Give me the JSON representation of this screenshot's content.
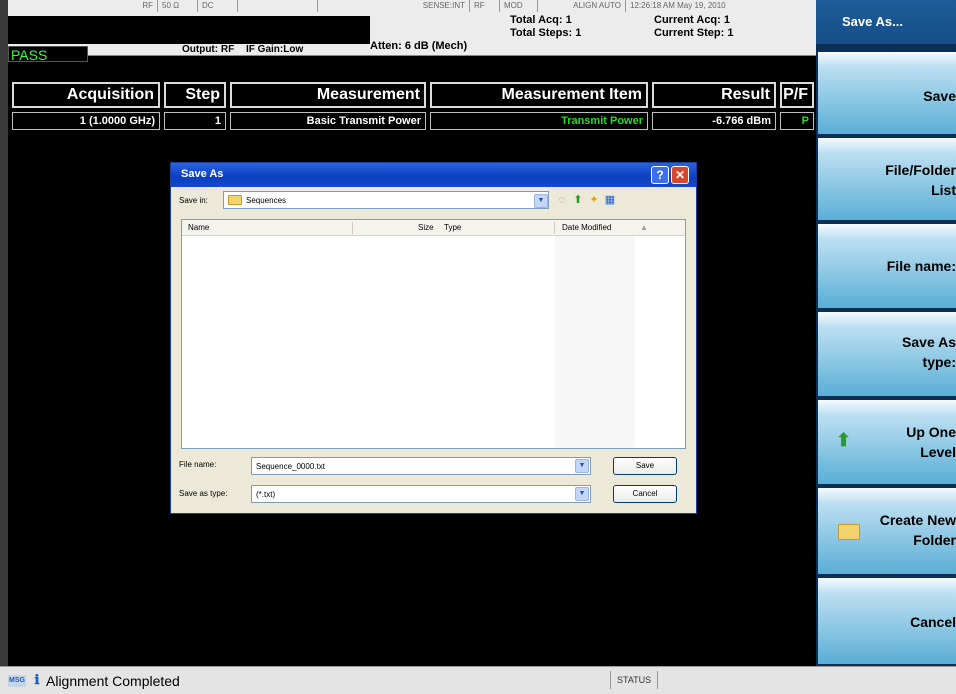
{
  "settings_bar": {
    "rf": "RF",
    "impedance": "50 Ω",
    "coupling": "DC",
    "sense": "SENSE:INT",
    "rf2": "RF",
    "mod": "MOD",
    "align": "ALIGN AUTO",
    "datetime": "12:26:18 AM May 19, 2010",
    "total_acq": "Total Acq: 1",
    "total_steps": "Total Steps: 1",
    "current_acq": "Current Acq: 1",
    "current_step": "Current Step: 1",
    "output": "Output: RF",
    "if_gain": "IF Gain:Low",
    "atten": "Atten: 6 dB (Mech)",
    "pass": "PASS"
  },
  "results_table": {
    "headers": [
      "Acquisition",
      "Step",
      "Measurement",
      "Measurement Item",
      "Result",
      "P/F"
    ],
    "row": {
      "acquisition": "1 (1.0000 GHz)",
      "step": "1",
      "measurement": "Basic Transmit Power",
      "item": "Transmit Power",
      "result": "-6.766 dBm",
      "pf": "P"
    }
  },
  "dialog": {
    "title": "Save As",
    "help": "?",
    "close": "✕",
    "save_in_label": "Save in:",
    "save_in_value": "Sequences",
    "columns": {
      "name": "Name",
      "size": "Size",
      "type": "Type",
      "date": "Date Modified"
    },
    "file_name_label": "File name:",
    "file_name_value": "Sequence_0000.txt",
    "save_type_label": "Save as type:",
    "save_type_value": "(*.txt)",
    "save_button": "Save",
    "cancel_button": "Cancel"
  },
  "softkeys": {
    "title": "Save As...",
    "keys": [
      "Save",
      "File/Folder\nList",
      "File name:",
      "Save As\ntype:",
      "Up One\nLevel",
      "Create New\nFolder",
      "Cancel"
    ]
  },
  "status": {
    "msg_tag": "MSG",
    "message": "Alignment Completed",
    "status_label": "STATUS"
  },
  "colors": {
    "pass_green": "#3cff3c",
    "softkey_blue": "#5aaed6",
    "titlebar_blue": "#0a3fc0"
  }
}
